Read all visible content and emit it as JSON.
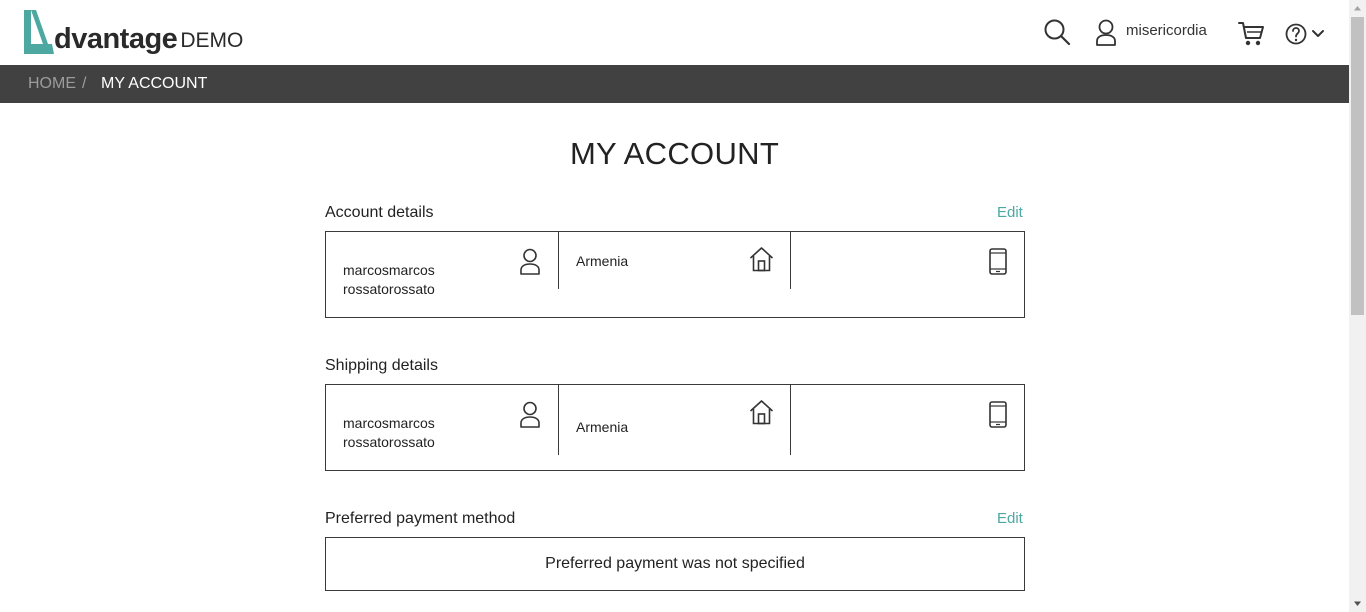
{
  "header": {
    "logo_word": "dvantage",
    "logo_suffix": "DEMO",
    "username": "misericordia",
    "icons": [
      "search-icon",
      "user-icon",
      "cart-icon",
      "help-icon",
      "chevron-down-icon"
    ]
  },
  "breadcrumb": {
    "home": "HOME",
    "separator": "/",
    "current": "MY ACCOUNT"
  },
  "page": {
    "title": "MY ACCOUNT"
  },
  "account_details": {
    "title": "Account details",
    "edit_label": "Edit",
    "name_line1": "marcosmarcos",
    "name_line2": "rossatorossato",
    "country": "Armenia",
    "phone": ""
  },
  "shipping_details": {
    "title": "Shipping details",
    "name_line1": "marcosmarcos",
    "name_line2": "rossatorossato",
    "country": "Armenia",
    "phone": ""
  },
  "payment": {
    "title": "Preferred payment method",
    "edit_label": "Edit",
    "message": "Preferred payment was not specified"
  },
  "colors": {
    "logo_teal": "#4ca8a0",
    "breadcrumb_bg": "#414141",
    "link": "#4ca8a0"
  }
}
